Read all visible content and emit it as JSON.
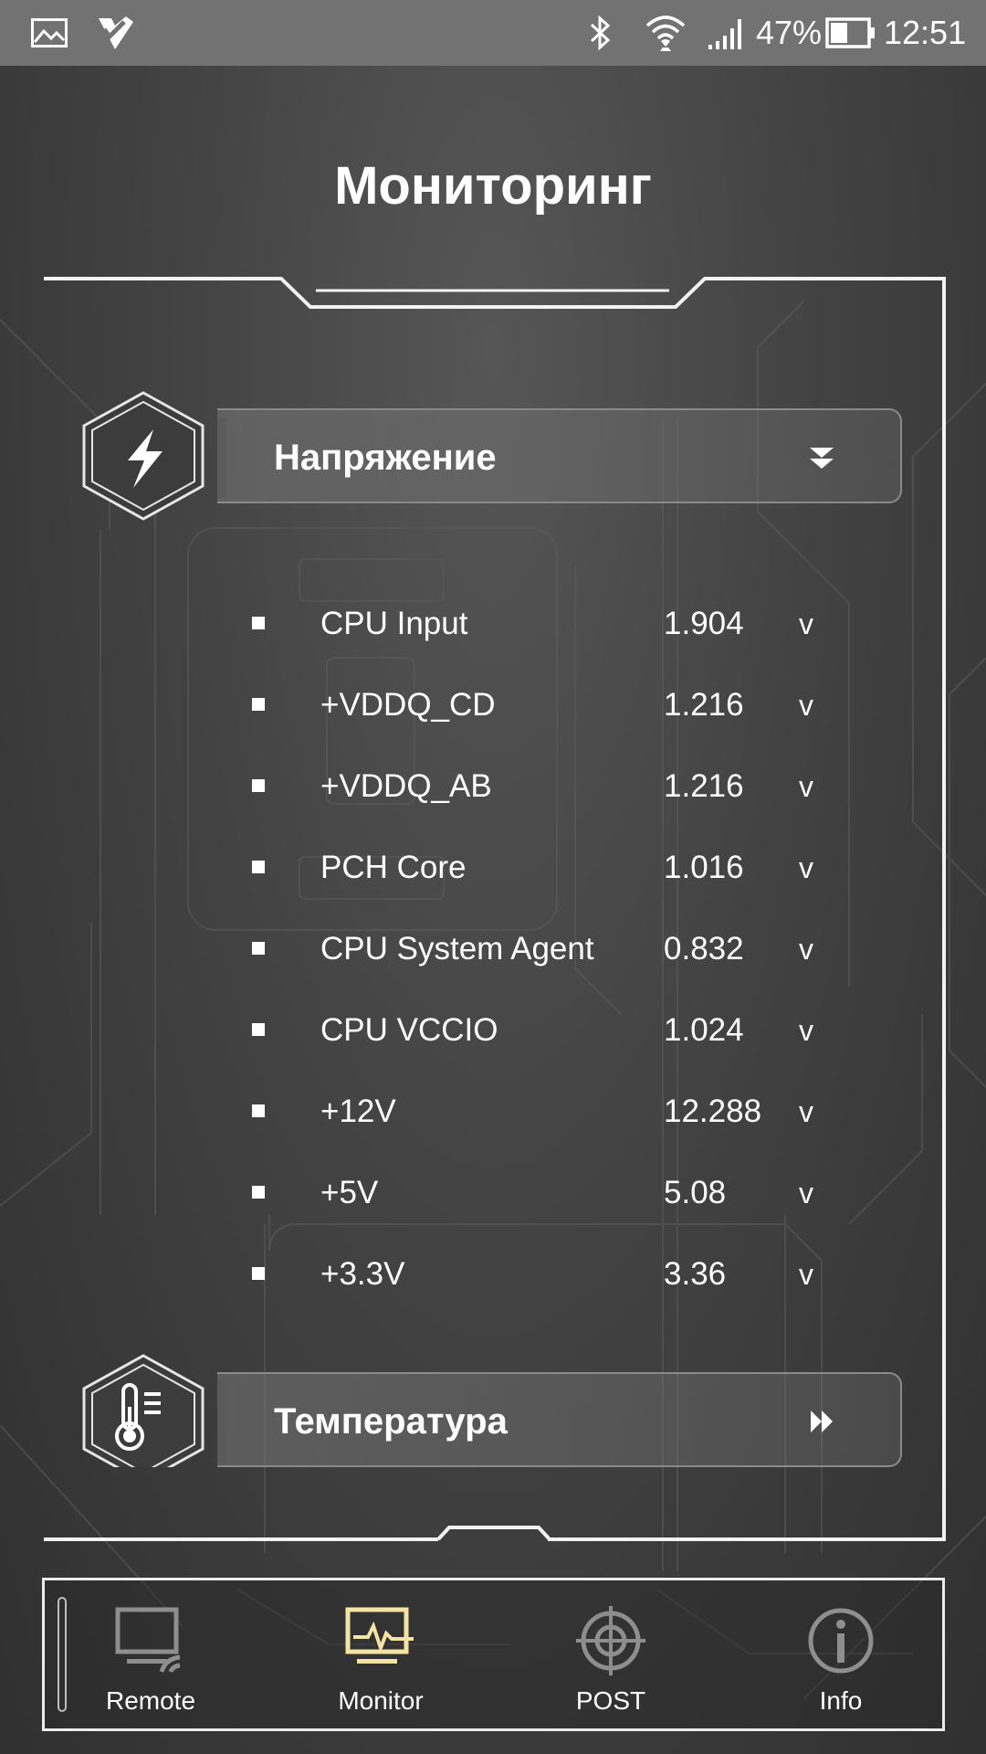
{
  "status_bar": {
    "battery_percent": "47%",
    "battery_level": 0.47,
    "time": "12:51",
    "icons": [
      "gallery-icon",
      "app-check-icon",
      "bluetooth-icon",
      "wifi-icon",
      "signal-icon",
      "battery-icon"
    ]
  },
  "page": {
    "title": "Мониторинг"
  },
  "voltage_section": {
    "title": "Напряжение",
    "icon": "lightning-icon",
    "arrow": "double-chevron-down-icon",
    "expanded": true,
    "items": [
      {
        "name": "CPU Input",
        "value": "1.904",
        "unit": "v"
      },
      {
        "name": "+VDDQ_CD",
        "value": "1.216",
        "unit": "v"
      },
      {
        "name": "+VDDQ_AB",
        "value": "1.216",
        "unit": "v"
      },
      {
        "name": "PCH Core",
        "value": "1.016",
        "unit": "v"
      },
      {
        "name": "CPU System Agent",
        "value": "0.832",
        "unit": "v"
      },
      {
        "name": "CPU VCCIO",
        "value": "1.024",
        "unit": "v"
      },
      {
        "name": "+12V",
        "value": "12.288",
        "unit": "v"
      },
      {
        "name": "+5V",
        "value": "5.08",
        "unit": "v"
      },
      {
        "name": "+3.3V",
        "value": "3.36",
        "unit": "v"
      }
    ]
  },
  "temperature_section": {
    "title": "Температура",
    "icon": "thermometer-icon",
    "arrow": "double-chevron-right-icon",
    "expanded": false
  },
  "bottom_nav": {
    "active": "Monitor",
    "active_color": "#f3e3a4",
    "items": [
      {
        "label": "Remote",
        "icon": "remote-icon"
      },
      {
        "label": "Monitor",
        "icon": "monitor-icon"
      },
      {
        "label": "POST",
        "icon": "crosshair-icon"
      },
      {
        "label": "Info",
        "icon": "info-icon"
      }
    ]
  }
}
